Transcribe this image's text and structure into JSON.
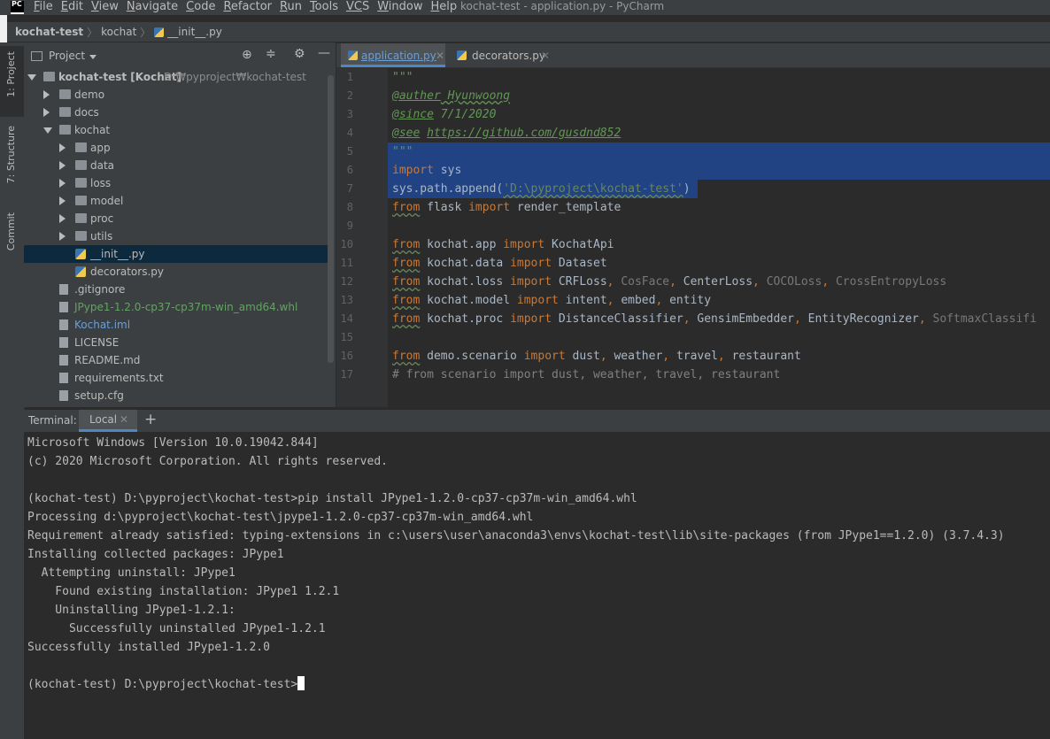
{
  "window": {
    "title": "kochat-test - application.py - PyCharm",
    "logo_text": "PC"
  },
  "menu": [
    {
      "ul": "F",
      "rest": "ile"
    },
    {
      "ul": "E",
      "rest": "dit"
    },
    {
      "ul": "V",
      "rest": "iew"
    },
    {
      "ul": "N",
      "rest": "avigate"
    },
    {
      "ul": "C",
      "rest": "ode"
    },
    {
      "ul": "R",
      "rest": "efactor"
    },
    {
      "ul": "R",
      "rest": "un"
    },
    {
      "ul": "T",
      "rest": "ools"
    },
    {
      "ul": "VC",
      "rest": "S"
    },
    {
      "ul": "W",
      "rest": "indow"
    },
    {
      "ul": "H",
      "rest": "elp"
    }
  ],
  "breadcrumb": [
    "kochat-test",
    "kochat",
    "__init__.py"
  ],
  "left_tabs": [
    "1: Project",
    "7: Structure",
    "Commit"
  ],
  "project": {
    "header": "Project",
    "root_label": "kochat-test [Kochat]",
    "root_path": "D:₩pyproject₩kochat-test",
    "items": [
      {
        "label": "demo",
        "type": "folder",
        "depth": 1,
        "state": "collapsed"
      },
      {
        "label": "docs",
        "type": "folder",
        "depth": 1,
        "state": "collapsed"
      },
      {
        "label": "kochat",
        "type": "folder",
        "depth": 1,
        "state": "expanded"
      },
      {
        "label": "app",
        "type": "folder",
        "depth": 2,
        "state": "collapsed"
      },
      {
        "label": "data",
        "type": "folder",
        "depth": 2,
        "state": "collapsed"
      },
      {
        "label": "loss",
        "type": "folder",
        "depth": 2,
        "state": "collapsed"
      },
      {
        "label": "model",
        "type": "folder",
        "depth": 2,
        "state": "collapsed"
      },
      {
        "label": "proc",
        "type": "folder",
        "depth": 2,
        "state": "collapsed"
      },
      {
        "label": "utils",
        "type": "folder",
        "depth": 2,
        "state": "collapsed"
      },
      {
        "label": "__init__.py",
        "type": "py",
        "depth": 2,
        "state": "selected"
      },
      {
        "label": "decorators.py",
        "type": "py",
        "depth": 2,
        "state": ""
      },
      {
        "label": ".gitignore",
        "type": "file",
        "depth": 1,
        "state": ""
      },
      {
        "label": "JPype1-1.2.0-cp37-cp37m-win_amd64.whl",
        "type": "file",
        "depth": 1,
        "state": "green"
      },
      {
        "label": "Kochat.iml",
        "type": "file",
        "depth": 1,
        "state": "blue"
      },
      {
        "label": "LICENSE",
        "type": "file",
        "depth": 1,
        "state": ""
      },
      {
        "label": "README.md",
        "type": "file",
        "depth": 1,
        "state": ""
      },
      {
        "label": "requirements.txt",
        "type": "file",
        "depth": 1,
        "state": ""
      },
      {
        "label": "setup.cfg",
        "type": "file",
        "depth": 1,
        "state": ""
      }
    ]
  },
  "editor": {
    "tabs": [
      {
        "label": "application.py",
        "active": true
      },
      {
        "label": "decorators.py",
        "active": false
      }
    ],
    "line_numbers": [
      "1",
      "2",
      "3",
      "4",
      "5",
      "6",
      "7",
      "8",
      "9",
      "10",
      "11",
      "12",
      "13",
      "14",
      "15",
      "16",
      "17"
    ],
    "lines": {
      "l1": "\"\"\"",
      "l2a": "@auther",
      "l2b": " Hyunwoong",
      "l3a": "@since",
      "l3b": " 7/1/2020",
      "l4a": "@see",
      "l4b": "https://github.com/gusdnd852",
      "l5": "\"\"\"",
      "l6a": "import",
      "l6b": " sys",
      "l7a": "sys.path.append(",
      "l7b": "'D:\\pyproject\\kochat-test'",
      "l7c": ")",
      "l8a": "from",
      "l8b": " flask ",
      "l8c": "import",
      "l8d": " render_template",
      "l10a": "from",
      "l10b": " kochat.app ",
      "l10c": "import",
      "l10d": " KochatApi",
      "l11a": "from",
      "l11b": " kochat.data ",
      "l11c": "import",
      "l11d": " Dataset",
      "l12a": "from",
      "l12b": " kochat.loss ",
      "l12c": "import",
      "l12d": " CRFLoss",
      "l12e": "CosFace",
      "l12f": "CenterLoss",
      "l12g": "COCOLoss",
      "l12h": "CrossEntropyLoss",
      "l13a": "from",
      "l13b": " kochat.model ",
      "l13c": "import",
      "l13d": " intent",
      "l13e": "embed",
      "l13f": "entity",
      "l14a": "from",
      "l14b": " kochat.proc ",
      "l14c": "import",
      "l14d": " DistanceClassifier",
      "l14e": "GensimEmbedder",
      "l14f": "EntityRecognizer",
      "l14g": "SoftmaxClassifi",
      "l16a": "from",
      "l16b": " demo.scenario ",
      "l16c": "import",
      "l16d": " dust",
      "l16e": "weather",
      "l16f": "travel",
      "l16g": "restaurant",
      "l17": "# from scenario import dust, weather, travel, restaurant",
      "comma": ", "
    }
  },
  "terminal": {
    "label": "Terminal:",
    "tab": "Local",
    "add": "+",
    "lines": [
      "Microsoft Windows [Version 10.0.19042.844]",
      "(c) 2020 Microsoft Corporation. All rights reserved.",
      "",
      "(kochat-test) D:\\pyproject\\kochat-test>pip install JPype1-1.2.0-cp37-cp37m-win_amd64.whl",
      "Processing d:\\pyproject\\kochat-test\\jpype1-1.2.0-cp37-cp37m-win_amd64.whl",
      "Requirement already satisfied: typing-extensions in c:\\users\\user\\anaconda3\\envs\\kochat-test\\lib\\site-packages (from JPype1==1.2.0) (3.7.4.3)",
      "Installing collected packages: JPype1",
      "  Attempting uninstall: JPype1",
      "    Found existing installation: JPype1 1.2.1",
      "    Uninstalling JPype1-1.2.1:",
      "      Successfully uninstalled JPype1-1.2.1",
      "Successfully installed JPype1-1.2.0",
      ""
    ],
    "prompt": "(kochat-test) D:\\pyproject\\kochat-test>"
  }
}
